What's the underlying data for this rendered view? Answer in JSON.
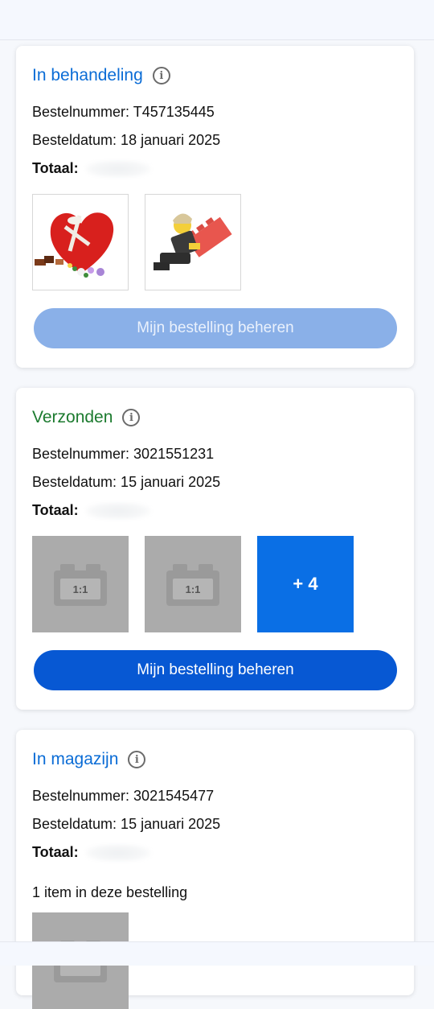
{
  "orders": [
    {
      "status": "In behandeling",
      "status_color": "#0a6cd6",
      "number_line": "Bestelnummer: T457135445",
      "date_line": "Besteldatum: 18 januari 2025",
      "total_label": "Totaal:",
      "button_label": "Mijn bestelling beheren"
    },
    {
      "status": "Verzonden",
      "status_color": "#1b7a2e",
      "number_line": "Bestelnummer: 3021551231",
      "date_line": "Besteldatum: 15 januari 2025",
      "total_label": "Totaal:",
      "placeholder_label": "1:1",
      "more_label": "+ 4",
      "button_label": "Mijn bestelling beheren"
    },
    {
      "status": "In magazijn",
      "status_color": "#0a6cd6",
      "number_line": "Bestelnummer: 3021545477",
      "date_line": "Besteldatum: 15 januari 2025",
      "total_label": "Totaal:",
      "items_text": "1 item in deze bestelling"
    }
  ],
  "icons": {
    "info": "info-circle-icon",
    "heart_product": "heart-box-product-image",
    "minifig_product": "minifigure-brick-product-image",
    "placeholder": "brick-placeholder-icon"
  }
}
